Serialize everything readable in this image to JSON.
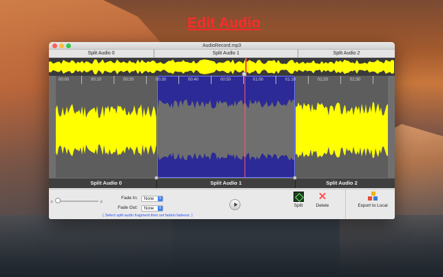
{
  "headline": "Edit Audio",
  "window": {
    "title": "AudioRecord.mp3"
  },
  "overview": {
    "segments": [
      "Split Audio 0",
      "Split Audio 1",
      "Split Audio 2"
    ]
  },
  "timeline": {
    "ticks": [
      "00:00",
      "00:10",
      "00:20",
      "00:30",
      "00:40",
      "00:50",
      "01:00",
      "01:10",
      "01:20",
      "01:30"
    ]
  },
  "segments": [
    "Split Audio 0",
    "Split Audio 1",
    "Split Audio 2"
  ],
  "controls": {
    "fade_in_label": "Fade In:",
    "fade_in_value": "None",
    "fade_out_label": "Fade Out:",
    "fade_out_value": "None",
    "hint": "( Select split audio fragment then set fadein fadeout. )",
    "split_label": "Split",
    "delete_label": "Delete",
    "export_label": "Export to Local"
  },
  "icons": {
    "zoom_out": "magnifier-minus-icon",
    "zoom_in": "magnifier-plus-icon",
    "play": "play-icon",
    "split": "split-icon",
    "delete": "delete-x-icon",
    "export": "export-blocks-icon"
  },
  "colors": {
    "waveform": "#ffff00",
    "selection": "#2c2a96",
    "playhead": "#ff3b3b",
    "headline": "#ff2a2a"
  }
}
